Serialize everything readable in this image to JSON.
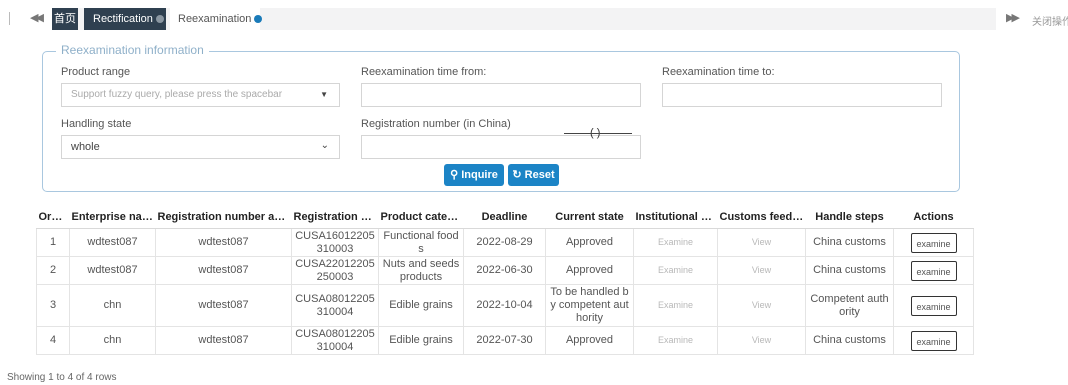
{
  "tabbar": {
    "prev_icon": "double-left-arrow",
    "next_icon": "double-right-arrow",
    "close_ops": "关闭操作",
    "tabs": [
      {
        "label": "首页"
      },
      {
        "label": "Rectification"
      },
      {
        "label": "Reexamination"
      }
    ]
  },
  "search": {
    "legend": "Reexamination information",
    "product_range": {
      "label": "Product range",
      "placeholder": "Support fuzzy query, please press the spacebar"
    },
    "time_from": {
      "label": "Reexamination time from:",
      "value": ""
    },
    "time_to": {
      "label": "Reexamination time to:",
      "value": ""
    },
    "handling_state": {
      "label": "Handling state",
      "value": "whole"
    },
    "registration_number": {
      "label": "Registration number (in China)",
      "value": ""
    },
    "ghost_text": "(      )",
    "inquire_label": "Inquire",
    "reset_label": "Reset"
  },
  "table": {
    "columns": [
      "Order",
      "Enterprise name",
      "Registration number approval",
      "Registration number",
      "Product category",
      "Deadline",
      "Current state",
      "Institutional feedback",
      "Customs feedback",
      "Handle steps",
      "Actions"
    ],
    "headers_display": [
      "Orde...",
      "Enterprise name",
      "Registration number appr...",
      "Registration nu...",
      "Product catego...",
      "Deadline",
      "Current state",
      "Institutional fe...",
      "Customs feedb...",
      "Handle steps",
      "Actions"
    ],
    "rows": [
      {
        "order": "1",
        "enterprise": "wdtest087",
        "approval": "wdtest087",
        "reg_no": "CUSA16012205310003",
        "category": "Functional foods",
        "deadline": "2022-08-29",
        "state": "Approved",
        "institutional": "Examine",
        "customs": "View",
        "steps": "China customs",
        "action": "examine"
      },
      {
        "order": "2",
        "enterprise": "wdtest087",
        "approval": "wdtest087",
        "reg_no": "CUSA22012205250003",
        "category": "Nuts and seeds products",
        "deadline": "2022-06-30",
        "state": "Approved",
        "institutional": "Examine",
        "customs": "View",
        "steps": "China customs",
        "action": "examine"
      },
      {
        "order": "3",
        "enterprise": "chn",
        "approval": "wdtest087",
        "reg_no": "CUSA08012205310004",
        "category": "Edible grains",
        "deadline": "2022-10-04",
        "state": "To be handled by competent authority",
        "institutional": "Examine",
        "customs": "View",
        "steps": "Competent authority",
        "action": "examine"
      },
      {
        "order": "4",
        "enterprise": "chn",
        "approval": "wdtest087",
        "reg_no": "CUSA08012205310004",
        "category": "Edible grains",
        "deadline": "2022-07-30",
        "state": "Approved",
        "institutional": "Examine",
        "customs": "View",
        "steps": "China customs",
        "action": "examine"
      }
    ]
  },
  "footer": {
    "summary": "Showing 1 to 4 of 4 rows"
  },
  "colors": {
    "tab_dark": "#2f4050",
    "accent": "#1c84c6",
    "panel_border": "#a9c7df"
  }
}
